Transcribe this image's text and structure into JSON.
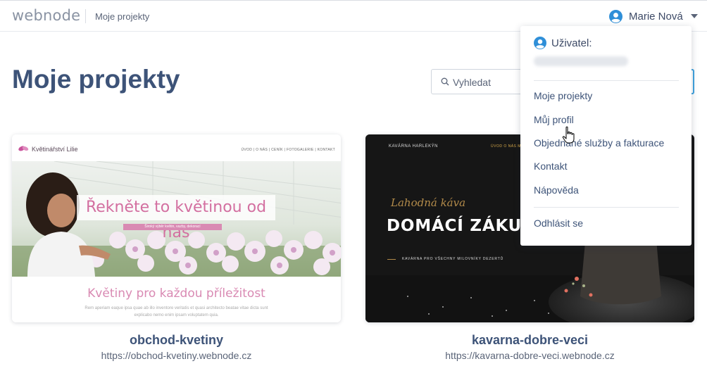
{
  "topbar": {
    "logo": "webnode",
    "breadcrumb": "Moje projekty",
    "user_name": "Marie Nová"
  },
  "page": {
    "title": "Moje projekty",
    "search_placeholder": "Vyhledat"
  },
  "colors": {
    "title": "#3d5378",
    "accent": "#3fa3e0",
    "user_icon": "#2f8fd8",
    "card1_pink": "#d36fa0",
    "card2_gold": "#b38b4a"
  },
  "projects": [
    {
      "name": "obchod-kvetiny",
      "url": "https://obchod-kvetiny.webnode.cz",
      "preview": {
        "brand": "Květinářství Lilie",
        "nav": "ÚVOD  |  O NÁS  |  CENÍK  |  FOTOGALERIE  |  KONTAKT",
        "headline": "Řekněte to květinou od nás",
        "subline": "Široký výběr květin, vazby, dekorací",
        "section_title": "Květiny pro každou příležitost",
        "section_text": "Rem aperiam eaque ipsa quae ab illo inventore veritatis et quasi architecto beatae vitae dicta sunt explicabo nemo enim ipsam voluptatem quia."
      }
    },
    {
      "name": "kavarna-dobre-veci",
      "url": "https://kavarna-dobre-veci.webnode.cz",
      "preview": {
        "brand": "KAVÁRNA HARLEKÝN",
        "nav": "ÚVOD     O NÁS     MENU     KONTAKT",
        "script": "Lahodná káva",
        "headline": "DOMÁCÍ ZÁKUSKY",
        "subline": "KAVÁRNA PRO VŠECHNY MILOVNÍKY DEZERTŮ"
      }
    }
  ],
  "dropdown": {
    "user_label": "Uživatel:",
    "items": [
      "Moje projekty",
      "Můj profil",
      "Objednané služby a fakturace",
      "Kontakt",
      "Nápověda"
    ],
    "logout": "Odhlásit se"
  }
}
